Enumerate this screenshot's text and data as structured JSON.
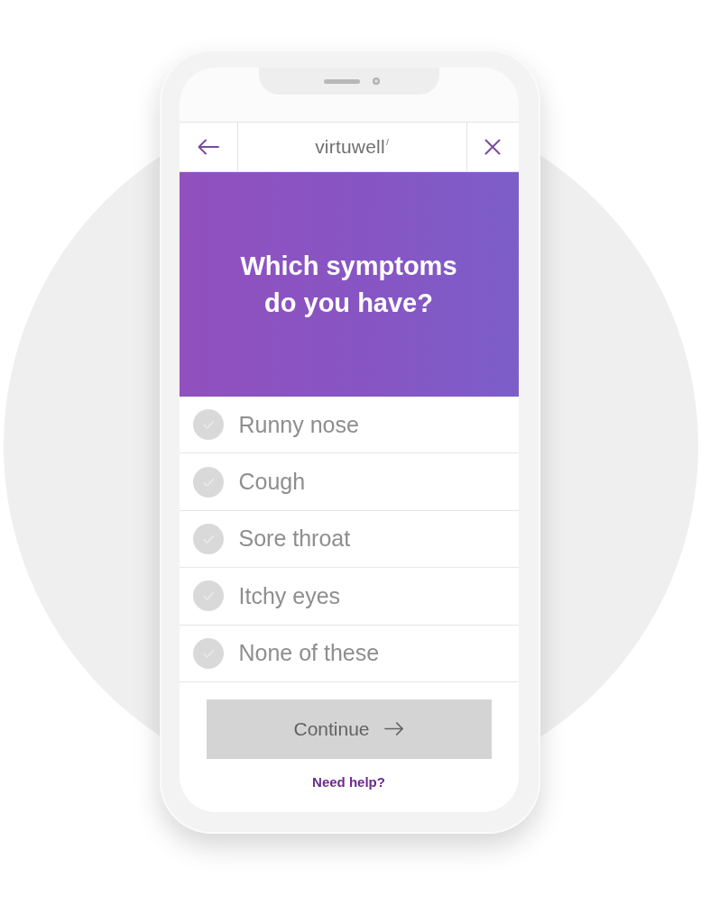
{
  "header": {
    "brand": "virtuwell"
  },
  "question": "Which symptoms do you have?",
  "options": [
    {
      "label": "Runny nose",
      "checked": false
    },
    {
      "label": "Cough",
      "checked": false
    },
    {
      "label": "Sore throat",
      "checked": false
    },
    {
      "label": "Itchy eyes",
      "checked": false
    },
    {
      "label": "None of these",
      "checked": false
    }
  ],
  "continue_button": {
    "label": "Continue",
    "disabled": true
  },
  "help_link": "Need help?"
}
